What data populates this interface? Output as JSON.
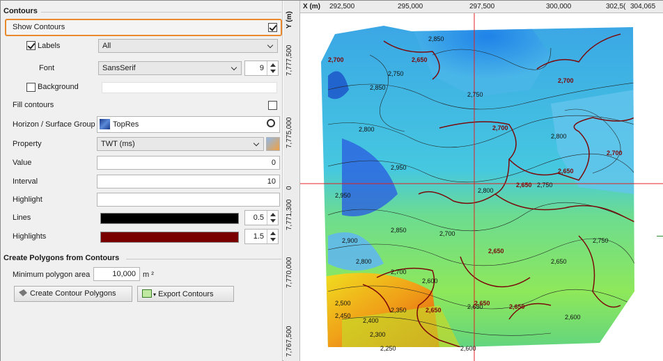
{
  "panel": {
    "section_contours": "Contours",
    "show_contours": {
      "label": "Show Contours",
      "checked": true
    },
    "labels": {
      "label": "Labels",
      "checked": true,
      "selected": "All"
    },
    "font": {
      "label": "Font",
      "selected": "SansSerif",
      "size": "9"
    },
    "background": {
      "label": "Background",
      "checked": false
    },
    "fill_contours": {
      "label": "Fill contours",
      "checked": false
    },
    "horizon": {
      "label": "Horizon / Surface Group",
      "value": "TopRes"
    },
    "property": {
      "label": "Property",
      "selected": "TWT (ms)"
    },
    "value": {
      "label": "Value",
      "value": "0"
    },
    "interval": {
      "label": "Interval",
      "value": "10"
    },
    "highlight": {
      "label": "Highlight",
      "value": ""
    },
    "lines": {
      "label": "Lines",
      "color": "#000000",
      "width": "0.5"
    },
    "highlights": {
      "label": "Highlights",
      "color": "#7a0000",
      "width": "1.5"
    },
    "section_polygons": "Create Polygons from Contours",
    "min_area": {
      "label": "Minimum polygon area",
      "value": "10,000",
      "unit": "m ²"
    },
    "create_button": "Create Contour Polygons",
    "export_button": "Export Contours"
  },
  "map": {
    "x_axis_label": "X (m)",
    "y_axis_label": "Y (m)",
    "x_ticks": [
      "292,500",
      "295,000",
      "297,500",
      "300,000",
      "302,5(",
      "304,065"
    ],
    "y_ticks": [
      "7,777,500",
      "7,775,000",
      "7,771,300",
      "7,770,000",
      "7,767,500"
    ],
    "y_zero": "0",
    "contour_labels": [
      "2,650",
      "2,700",
      "2,750",
      "2,800",
      "2,850",
      "2,900",
      "2,950",
      "2,600",
      "2,500",
      "2,450",
      "2,400",
      "2,350",
      "2,300",
      "2,250"
    ],
    "colors": {
      "crosshair": "#e02020",
      "highlight": "#7a0a0a",
      "accent": "#e8892d"
    }
  }
}
